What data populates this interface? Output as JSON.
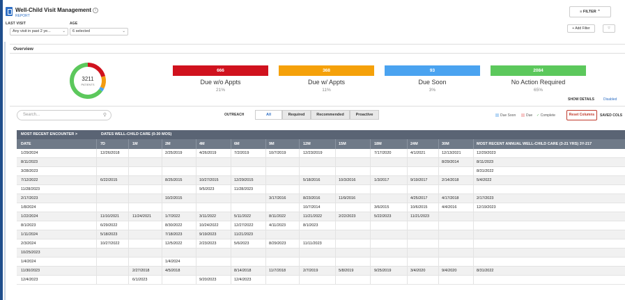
{
  "header": {
    "title": "Well-Child Visit Management",
    "subtitle": "REPORT",
    "info_icon": "i",
    "filter_label": "FILTER",
    "filters": {
      "last_visit_label": "LAST VISIT",
      "last_visit_value": "Any visit in past 2 ye...",
      "age_label": "AGE",
      "age_value": "6 selected"
    },
    "add_filter_label": "+ Add Filter"
  },
  "overview": {
    "title": "Overview",
    "total": "3211",
    "total_label": "PATIENTS",
    "donut_segments": [
      {
        "name": "Due w/o Appts",
        "value": 666,
        "color": "#d0121e"
      },
      {
        "name": "Due w/ Appts",
        "value": 368,
        "color": "#f39c12"
      },
      {
        "name": "Due Soon",
        "value": 93,
        "color": "#4aa3f0"
      },
      {
        "name": "No Action Required",
        "value": 2084,
        "color": "#5cc85c"
      }
    ],
    "kpis": [
      {
        "value": "666",
        "name": "Due w/o Appts",
        "pct": "21%",
        "color": "#d0121e"
      },
      {
        "value": "368",
        "name": "Due w/ Appts",
        "pct": "11%",
        "color": "#f5a10a"
      },
      {
        "value": "93",
        "name": "Due Soon",
        "pct": "3%",
        "color": "#4aa3f0"
      },
      {
        "value": "2084",
        "name": "No Action Required",
        "pct": "65%",
        "color": "#5cc85c"
      }
    ],
    "show_details_label": "SHOW DETAILS",
    "show_details_value": "Disabled"
  },
  "toolbar": {
    "search_placeholder": "Search...",
    "outreach_label": "OUTREACH",
    "tabs": [
      "All",
      "Required",
      "Recommended",
      "Proactive"
    ],
    "legend": [
      {
        "label": "Due Soon",
        "color": "#b9d8f5"
      },
      {
        "label": "Due",
        "color": "#f7c9c9"
      },
      {
        "label": "Complete",
        "color": "#5cb85c"
      }
    ],
    "reset_label": "Reset Columns",
    "saved_label": "SAVED COLS"
  },
  "table": {
    "group_headers": [
      "MOST RECENT ENCOUNTER  >",
      "DATES WELL-CHILD CARE (0-30 MOS)"
    ],
    "columns": [
      "DATE",
      "7D",
      "1M",
      "2M",
      "4M",
      "6M",
      "9M",
      "12M",
      "15M",
      "18M",
      "24M",
      "30M",
      "MOST RECENT ANNUAL WELL-CHILD CARE (3-21 YRS) 3Y-217"
    ],
    "rows": [
      [
        "1/29/2024",
        "12/26/2018",
        "",
        "2/25/2019",
        "4/26/2019",
        "7/2/2019",
        "10/7/2019",
        "12/23/2019",
        "",
        "7/17/2020",
        "4/1/2021",
        "12/13/2021",
        "12/29/2023"
      ],
      [
        "8/11/2023",
        "",
        "",
        "",
        "",
        "",
        "",
        "",
        "",
        "",
        "",
        "8/29/2014",
        "8/11/2023"
      ],
      [
        "3/28/2023",
        "",
        "",
        "",
        "",
        "",
        "",
        "",
        "",
        "",
        "",
        "",
        "8/31/2022"
      ],
      [
        "7/12/2022",
        "6/22/2015",
        "",
        "8/25/2015",
        "10/27/2015",
        "12/29/2015",
        "",
        "5/18/2016",
        "10/3/2016",
        "1/3/2017",
        "9/19/2017",
        "2/14/2018",
        "5/4/2022"
      ],
      [
        "11/28/2023",
        "",
        "",
        "",
        "9/5/2023",
        "11/28/2023",
        "",
        "",
        "",
        "",
        "",
        "",
        ""
      ],
      [
        "2/17/2023",
        "",
        "",
        "10/2/2015",
        "",
        "",
        "3/17/2016",
        "8/23/2016",
        "11/9/2016",
        "",
        "4/25/2017",
        "4/17/2018",
        "2/17/2023"
      ],
      [
        "1/8/2024",
        "",
        "",
        "",
        "",
        "",
        "",
        "10/7/2014",
        "",
        "3/6/2015",
        "10/6/2015",
        "4/4/2016",
        "12/19/2023"
      ],
      [
        "1/22/2024",
        "11/10/2021",
        "11/24/2021",
        "1/7/2022",
        "3/11/2022",
        "5/11/2022",
        "8/11/2022",
        "11/21/2022",
        "2/22/2023",
        "5/22/2023",
        "11/21/2023",
        "",
        ""
      ],
      [
        "8/1/2023",
        "6/29/2022",
        "",
        "8/30/2022",
        "10/24/2022",
        "12/27/2022",
        "4/11/2023",
        "8/1/2023",
        "",
        "",
        "",
        "",
        ""
      ],
      [
        "1/11/2024",
        "5/18/2023",
        "",
        "7/18/2023",
        "9/19/2023",
        "11/21/2023",
        "",
        "",
        "",
        "",
        "",
        "",
        ""
      ],
      [
        "2/3/2024",
        "10/27/2022",
        "",
        "12/5/2022",
        "2/23/2023",
        "5/6/2023",
        "8/29/2023",
        "11/11/2023",
        "",
        "",
        "",
        "",
        ""
      ],
      [
        "10/25/2023",
        "",
        "",
        "",
        "",
        "",
        "",
        "",
        "",
        "",
        "",
        "",
        ""
      ],
      [
        "1/4/2024",
        "",
        "",
        "1/4/2024",
        "",
        "",
        "",
        "",
        "",
        "",
        "",
        "",
        ""
      ],
      [
        "11/30/2023",
        "",
        "2/27/2018",
        "4/5/2018",
        "",
        "8/14/2018",
        "11/7/2018",
        "2/7/2019",
        "5/8/2019",
        "9/25/2019",
        "3/4/2020",
        "9/4/2020",
        "8/31/2022"
      ],
      [
        "12/4/2023",
        "",
        "6/1/2023",
        "",
        "9/20/2023",
        "12/4/2023",
        "",
        "",
        "",
        "",
        "",
        "",
        ""
      ]
    ]
  }
}
